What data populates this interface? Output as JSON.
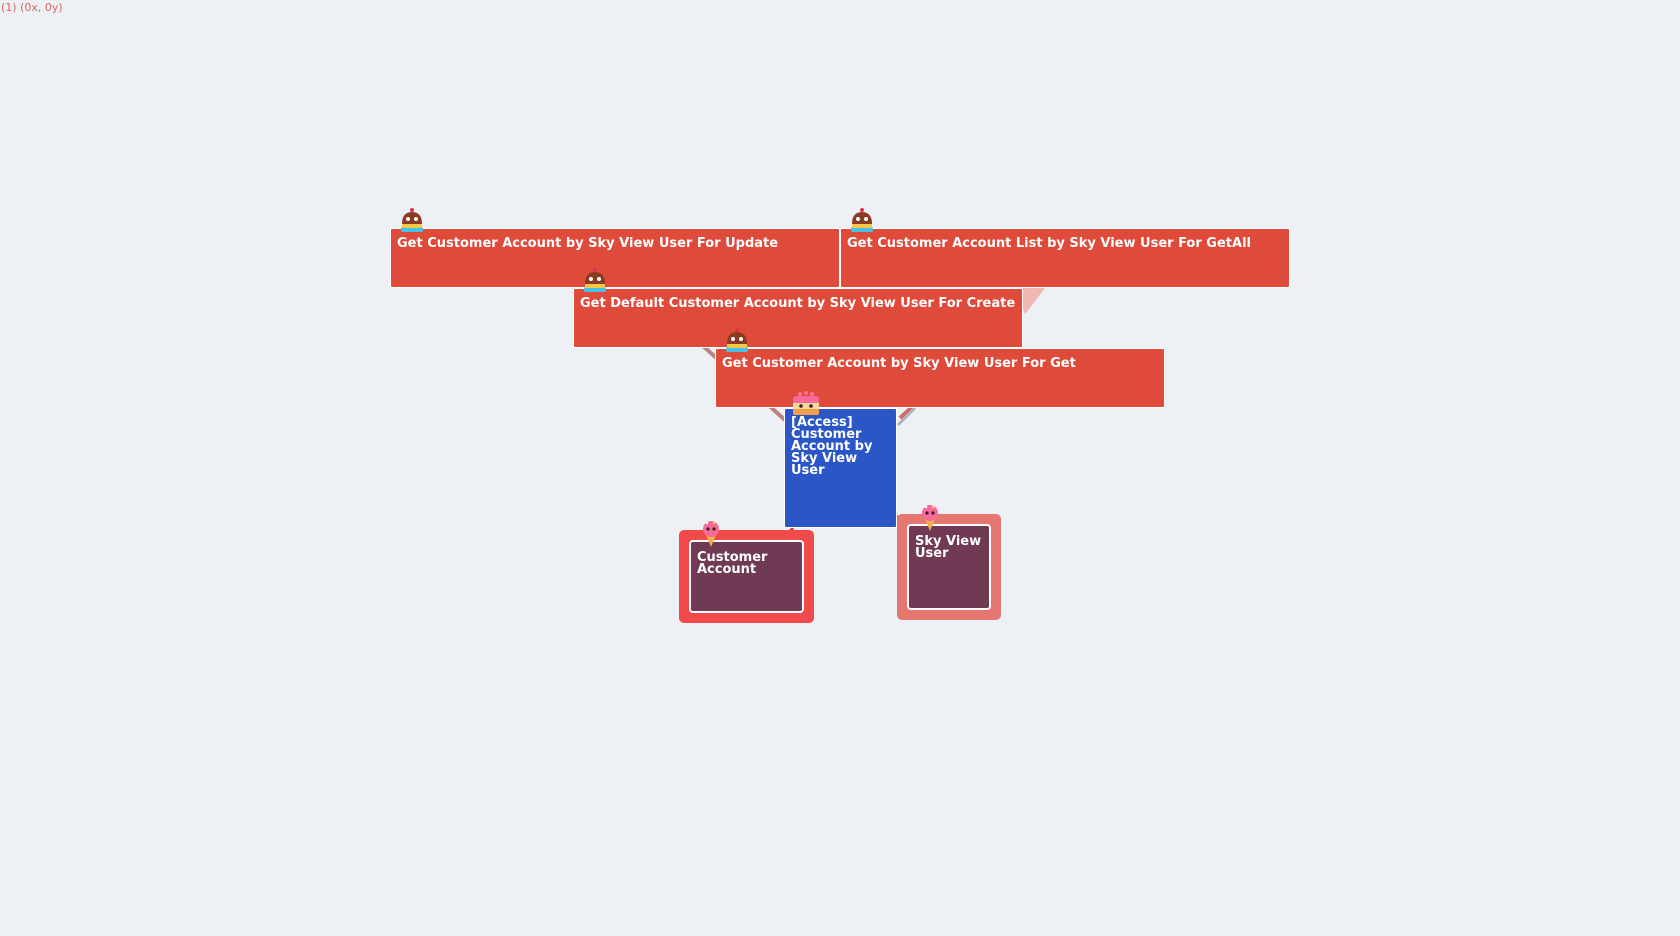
{
  "coordinate_readout": "(1) (0x, 0y)",
  "colors": {
    "background": "#edf0f4",
    "operation": "#df4b3b",
    "access": "#2b56c6",
    "entity_inner": "#703a55",
    "entity_frame_primary": "#f24a4a",
    "entity_frame_secondary": "#e57770"
  },
  "nodes": {
    "op_update": {
      "label": "Get Customer Account by Sky View User For Update",
      "icon": "cake-icon"
    },
    "op_getall": {
      "label": "Get Customer Account List by Sky View User For GetAll",
      "icon": "cake-icon"
    },
    "op_create": {
      "label": "Get Default Customer Account by Sky View User For Create",
      "icon": "cake-icon"
    },
    "op_get": {
      "label": "Get Customer Account by Sky View User For Get",
      "icon": "cake-icon"
    },
    "access": {
      "label": "[Access] Customer Account by Sky View User",
      "icon": "layer-cake-icon"
    },
    "entity_customer": {
      "label": "Customer Account",
      "icon": "ice-cream-icon"
    },
    "entity_user": {
      "label": "Sky View User",
      "icon": "ice-cream-icon"
    }
  }
}
